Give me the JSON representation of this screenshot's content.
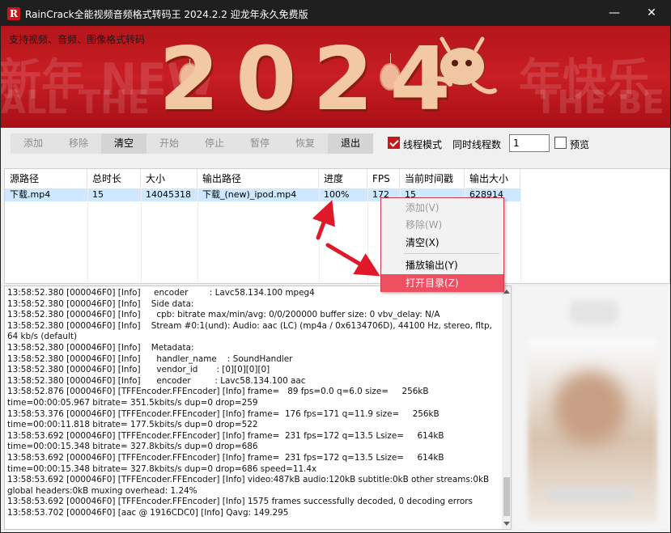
{
  "window": {
    "app_icon_letter": "R",
    "title": "RainCrack全能视频音频格式转码王 2024.2.2 迎龙年永久免费版",
    "minimize_glyph": "—",
    "close_glyph": "✕"
  },
  "banner": {
    "subtitle": "支持视频、音频、图像格式转码",
    "year": "2024"
  },
  "toolbar": {
    "add": "添加",
    "remove": "移除",
    "clear": "清空",
    "start": "开始",
    "stop": "停止",
    "pause": "暂停",
    "resume": "恢复",
    "exit": "退出",
    "thread_mode_label": "线程模式",
    "thread_mode_checked": true,
    "thread_count_label": "同时线程数",
    "thread_count_value": "1",
    "preview_label": "预览",
    "preview_checked": false
  },
  "table": {
    "headers": [
      "源路径",
      "总时长",
      "大小",
      "输出路径",
      "进度",
      "FPS",
      "当前时间戳",
      "输出大小"
    ],
    "rows": [
      [
        "下载.mp4",
        "15",
        "14045318",
        "下载_(new)_ipod.mp4",
        "100%",
        "172",
        "15",
        "628914"
      ]
    ]
  },
  "context_menu": {
    "items": [
      "添加(V)",
      "移除(W)",
      "清空(X)",
      "播放输出(Y)",
      "打开目录(Z)"
    ],
    "disabled": [
      true,
      true,
      false,
      false,
      false
    ],
    "highlighted_index": 4
  },
  "log": {
    "lines": [
      "13:58:52.380 [000046F0] [Info]     encoder        : Lavc58.134.100 mpeg4",
      "13:58:52.380 [000046F0] [Info]    Side data:",
      "13:58:52.380 [000046F0] [Info]      cpb: bitrate max/min/avg: 0/0/200000 buffer size: 0 vbv_delay: N/A",
      "13:58:52.380 [000046F0] [Info]    Stream #0:1(und): Audio: aac (LC) (mp4a / 0x6134706D), 44100 Hz, stereo, fltp, 64 kb/s (default)",
      "13:58:52.380 [000046F0] [Info]    Metadata:",
      "13:58:52.380 [000046F0] [Info]      handler_name    : SoundHandler",
      "13:58:52.380 [000046F0] [Info]      vendor_id       : [0][0][0][0]",
      "13:58:52.380 [000046F0] [Info]      encoder         : Lavc58.134.100 aac",
      "13:58:52.876 [000046F0] [TFFEncoder.FFEncoder] [Info] frame=   89 fps=0.0 q=6.0 size=     256kB time=00:00:05.967 bitrate= 351.5kbits/s dup=0 drop=259",
      "13:58:53.376 [000046F0] [TFFEncoder.FFEncoder] [Info] frame=  176 fps=171 q=11.9 size=     256kB time=00:00:11.818 bitrate= 177.5kbits/s dup=0 drop=522",
      "13:58:53.692 [000046F0] [TFFEncoder.FFEncoder] [Info] frame=  231 fps=172 q=13.5 Lsize=     614kB time=00:00:15.348 bitrate= 327.8kbits/s dup=0 drop=686",
      "13:58:53.692 [000046F0] [TFFEncoder.FFEncoder] [Info] frame=  231 fps=172 q=13.5 Lsize=     614kB time=00:00:15.348 bitrate= 327.8kbits/s dup=0 drop=686 speed=11.4x",
      "13:58:53.692 [000046F0] [TFFEncoder.FFEncoder] [Info] video:487kB audio:120kB subtitle:0kB other streams:0kB global headers:0kB muxing overhead: 1.24%",
      "13:58:53.692 [000046F0] [TFFEncoder.FFEncoder] [Info] 1575 frames successfully decoded, 0 decoding errors",
      "13:58:53.702 [000046F0] [aac @ 1916CDC0] [Info] Qavg: 149.295"
    ]
  },
  "colors": {
    "title_bar": "#1f1f1f",
    "banner_red": "#c81e24",
    "selection_row": "#cde8ff",
    "menu_highlight": "#ef4f61",
    "annotation_arrow": "#e0182a"
  }
}
